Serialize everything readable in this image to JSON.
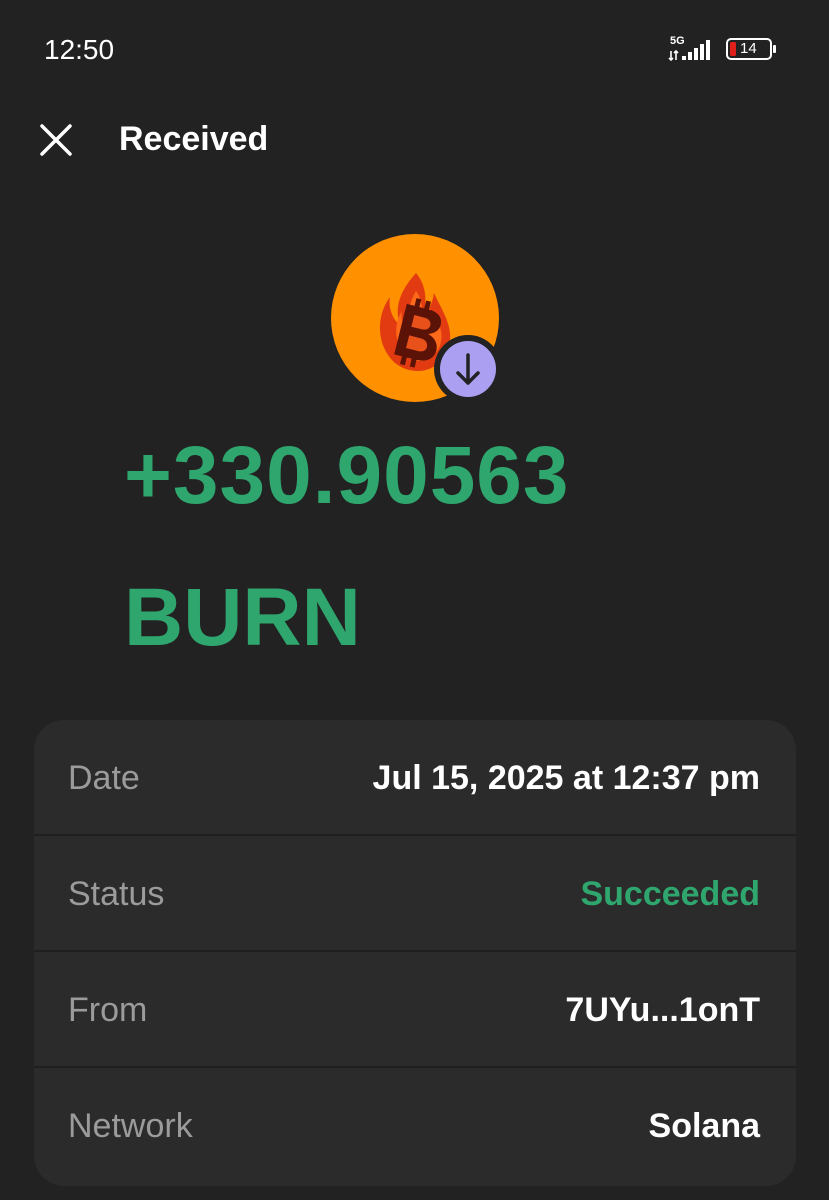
{
  "status_bar": {
    "time": "12:50",
    "network": "5G",
    "battery": "14",
    "battery_color": "#e0201b"
  },
  "header": {
    "title": "Received",
    "close_icon": "close-icon"
  },
  "token": {
    "icon": "bitcoin-fire-logo",
    "badge_icon": "arrow-down-icon",
    "amount": "+330.90563",
    "symbol": "BURN"
  },
  "colors": {
    "accent_green": "#2fa66e",
    "token_orange": "#ff9100",
    "badge_purple": "#ab9ff2",
    "background": "#222222",
    "card": "#2b2b2b"
  },
  "details": [
    {
      "label": "Date",
      "value": "Jul 15, 2025 at 12:37 pm"
    },
    {
      "label": "Status",
      "value": "Succeeded"
    },
    {
      "label": "From",
      "value": "7UYu...1onT"
    },
    {
      "label": "Network",
      "value": "Solana"
    }
  ]
}
